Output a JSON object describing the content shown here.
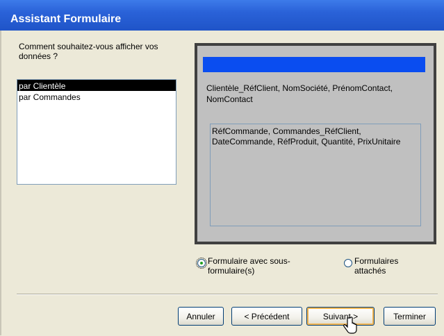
{
  "window": {
    "title": "Assistant Formulaire"
  },
  "question": "Comment souhaitez-vous afficher vos données ?",
  "list": {
    "items": [
      "par Clientèle",
      "par Commandes"
    ],
    "selected_index": 0
  },
  "preview": {
    "main_fields": "Clientèle_RéfClient, NomSociété, PrénomContact, NomContact",
    "sub_fields": "RéfCommande, Commandes_RéfClient, DateCommande, RéfProduit, Quantité, PrixUnitaire"
  },
  "options": [
    {
      "label": "Formulaire avec sous-formulaire(s)",
      "checked": true
    },
    {
      "label": "Formulaires attachés",
      "checked": false
    }
  ],
  "buttons": {
    "cancel": "Annuler",
    "previous": "< Précédent",
    "next": "Suivant >",
    "finish": "Terminer"
  },
  "colors": {
    "titlebar": "#2a62d8",
    "preview_bar": "#0a4df0",
    "preview_bg": "#c0c0c0"
  }
}
